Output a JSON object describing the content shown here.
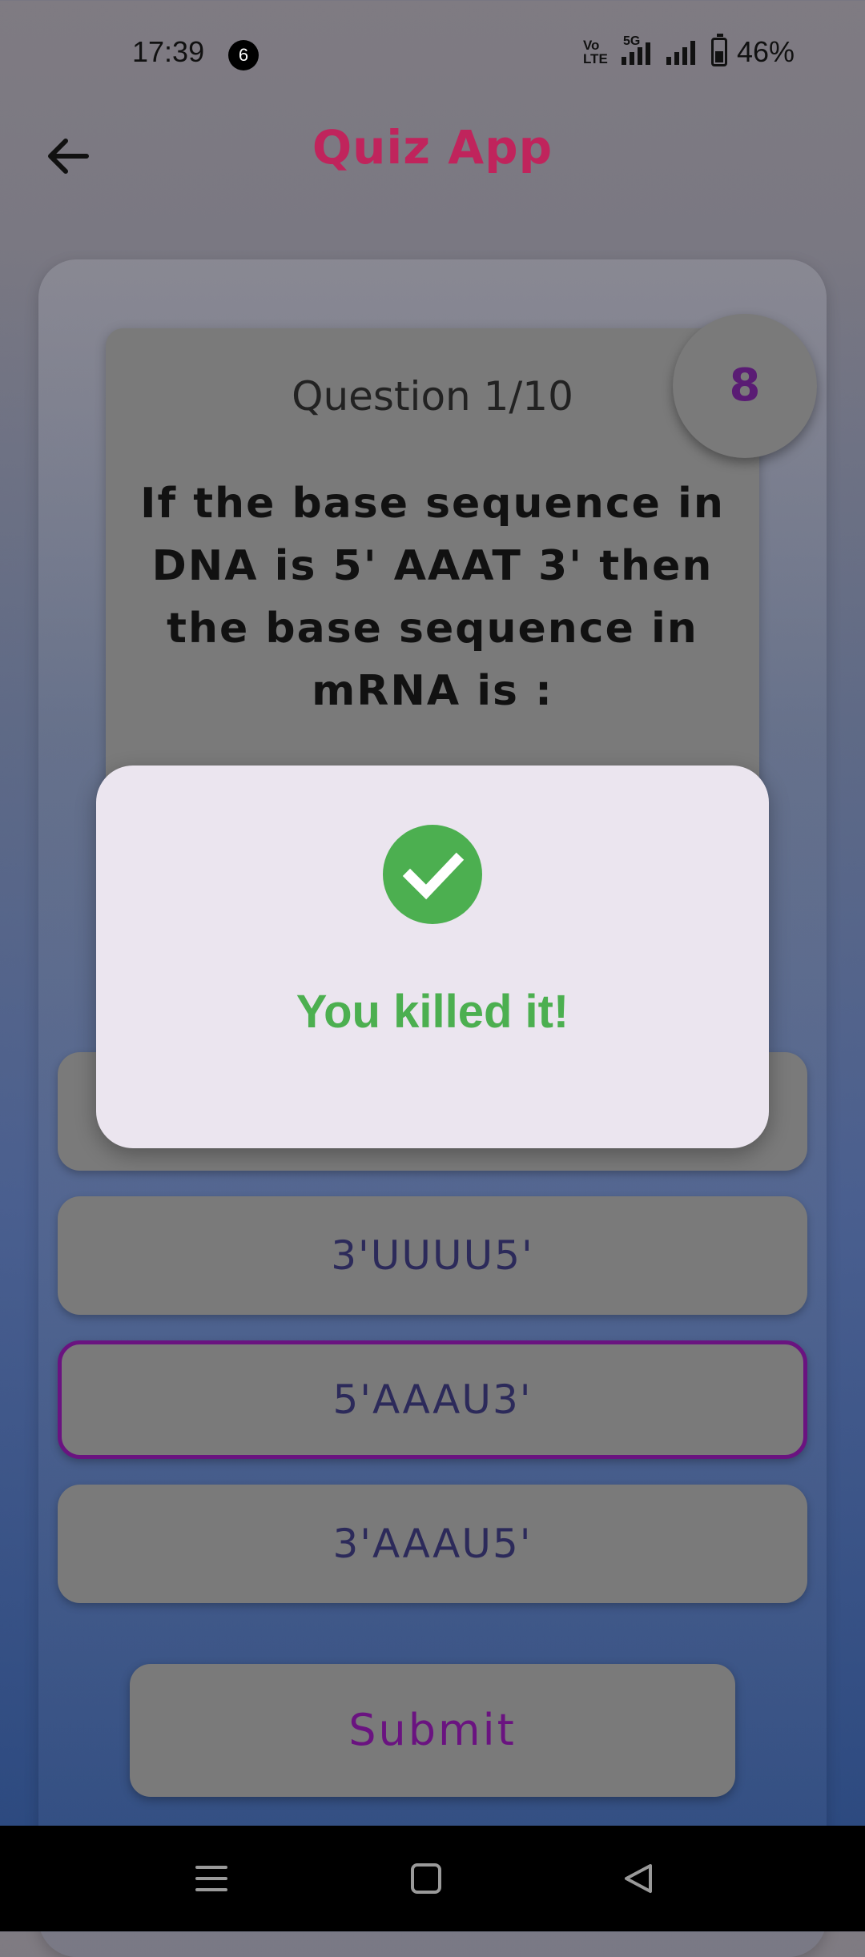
{
  "status_bar": {
    "time": "17:39",
    "notification_count": "6",
    "volte_label": "Vo\nLTE",
    "network_label": "5G",
    "battery": "46%"
  },
  "app_bar": {
    "title": "Quiz App",
    "back_icon": "arrow-left-icon"
  },
  "question": {
    "counter": "Question 1/10",
    "text": "If the base sequence in DNA is 5' AAAT 3' then the base sequence in mRNA is :",
    "timer": "8"
  },
  "options": [
    {
      "label": "",
      "selected": false
    },
    {
      "label": "3'UUUU5'",
      "selected": false
    },
    {
      "label": "5'AAAU3'",
      "selected": true
    },
    {
      "label": "3'AAAU5'",
      "selected": false
    }
  ],
  "submit_label": "Submit",
  "dialog": {
    "icon": "check-circle-icon",
    "message": "You killed it!"
  },
  "colors": {
    "accent": "#c0245c",
    "purple": "#6a1380",
    "success": "#4caf50"
  },
  "nav_bar": {
    "icons": [
      "menu-icon",
      "home-square-icon",
      "back-triangle-icon"
    ]
  }
}
